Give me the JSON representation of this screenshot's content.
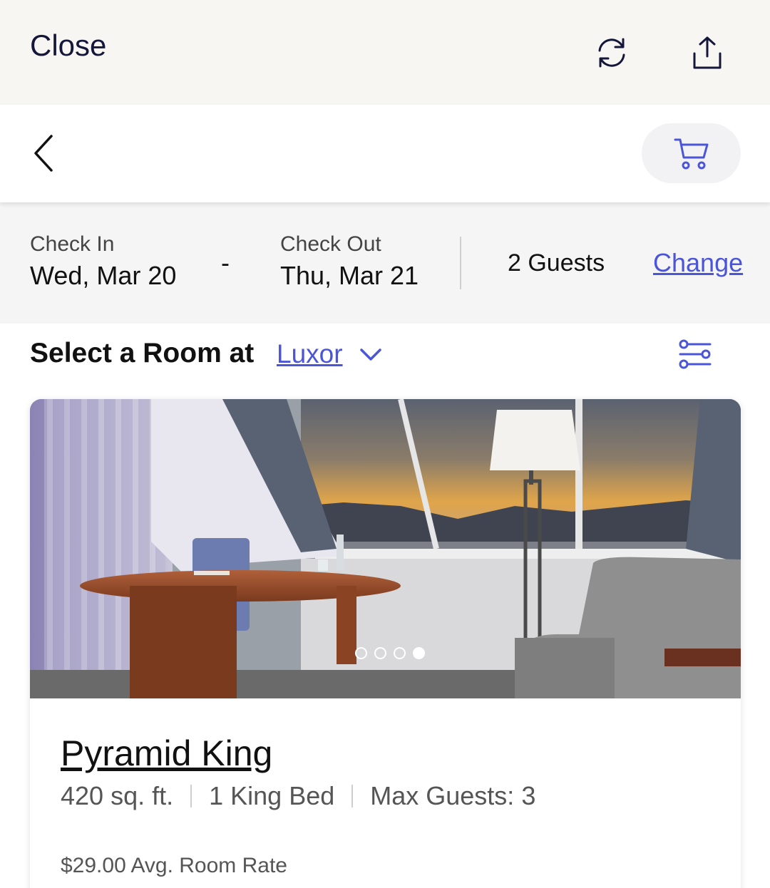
{
  "browser": {
    "close_label": "Close",
    "refresh_icon": "refresh-icon",
    "share_icon": "share-icon"
  },
  "nav": {
    "back_icon": "chevron-left-icon",
    "cart_icon": "cart-icon"
  },
  "stay": {
    "check_in_label": "Check In",
    "check_in_value": "Wed, Mar 20",
    "separator": "-",
    "check_out_label": "Check Out",
    "check_out_value": "Thu, Mar 21",
    "guests": "2 Guests",
    "change_label": "Change"
  },
  "selection": {
    "heading": "Select a Room at",
    "hotel": "Luxor",
    "hotel_chevron_icon": "chevron-down-icon",
    "filter_icon": "filter-sliders-icon"
  },
  "room": {
    "name": "Pyramid King",
    "size": "420 sq. ft.",
    "bed": "1 King Bed",
    "max_guests": "Max Guests: 3",
    "rate": "$29.00 Avg. Room Rate",
    "carousel": {
      "count": 4,
      "active_index": 3
    }
  },
  "colors": {
    "accent": "#4b55d8",
    "title_navy": "#14163a",
    "topbar_bg": "#f7f6f3",
    "strip_bg": "#f5f5f5"
  }
}
